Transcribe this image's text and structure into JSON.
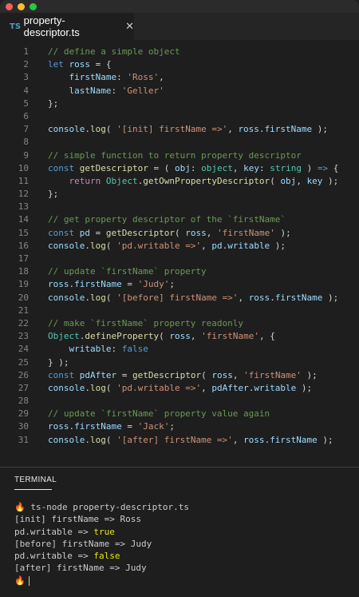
{
  "tab": {
    "type_label": "TS",
    "filename": "property-descriptor.ts"
  },
  "lines": [
    {
      "n": "1",
      "t": [
        [
          "cm",
          "// define a simple object"
        ]
      ]
    },
    {
      "n": "2",
      "t": [
        [
          "kw",
          "let "
        ],
        [
          "vr",
          "ross"
        ],
        [
          "pn",
          " = {"
        ]
      ]
    },
    {
      "n": "3",
      "t": [
        [
          "pn",
          "    "
        ],
        [
          "vr",
          "firstName"
        ],
        [
          "pn",
          ": "
        ],
        [
          "st",
          "'Ross'"
        ],
        [
          "pn",
          ","
        ]
      ]
    },
    {
      "n": "4",
      "t": [
        [
          "pn",
          "    "
        ],
        [
          "vr",
          "lastName"
        ],
        [
          "pn",
          ": "
        ],
        [
          "st",
          "'Geller'"
        ]
      ]
    },
    {
      "n": "5",
      "t": [
        [
          "pn",
          "};"
        ]
      ]
    },
    {
      "n": "6",
      "t": []
    },
    {
      "n": "7",
      "t": [
        [
          "vr",
          "console"
        ],
        [
          "pn",
          "."
        ],
        [
          "fn",
          "log"
        ],
        [
          "pn",
          "( "
        ],
        [
          "st",
          "'[init] firstName =>'"
        ],
        [
          "pn",
          ", "
        ],
        [
          "vr",
          "ross"
        ],
        [
          "pn",
          "."
        ],
        [
          "vr",
          "firstName"
        ],
        [
          "pn",
          " );"
        ]
      ]
    },
    {
      "n": "8",
      "t": []
    },
    {
      "n": "9",
      "t": [
        [
          "cm",
          "// simple function to return property descriptor"
        ]
      ]
    },
    {
      "n": "10",
      "t": [
        [
          "kw",
          "const "
        ],
        [
          "fn",
          "getDescriptor"
        ],
        [
          "pn",
          " = ( "
        ],
        [
          "vr",
          "obj"
        ],
        [
          "pn",
          ": "
        ],
        [
          "cls",
          "object"
        ],
        [
          "pn",
          ", "
        ],
        [
          "vr",
          "key"
        ],
        [
          "pn",
          ": "
        ],
        [
          "cls",
          "string"
        ],
        [
          "pn",
          " ) "
        ],
        [
          "kw",
          "=>"
        ],
        [
          "pn",
          " {"
        ]
      ]
    },
    {
      "n": "11",
      "t": [
        [
          "pn",
          "    "
        ],
        [
          "ctl",
          "return "
        ],
        [
          "cls",
          "Object"
        ],
        [
          "pn",
          "."
        ],
        [
          "fn",
          "getOwnPropertyDescriptor"
        ],
        [
          "pn",
          "( "
        ],
        [
          "vr",
          "obj"
        ],
        [
          "pn",
          ", "
        ],
        [
          "vr",
          "key"
        ],
        [
          "pn",
          " );"
        ]
      ]
    },
    {
      "n": "12",
      "t": [
        [
          "pn",
          "};"
        ]
      ]
    },
    {
      "n": "13",
      "t": []
    },
    {
      "n": "14",
      "t": [
        [
          "cm",
          "// get property descriptor of the `firstName`"
        ]
      ]
    },
    {
      "n": "15",
      "t": [
        [
          "kw",
          "const "
        ],
        [
          "vr",
          "pd"
        ],
        [
          "pn",
          " = "
        ],
        [
          "fn",
          "getDescriptor"
        ],
        [
          "pn",
          "( "
        ],
        [
          "vr",
          "ross"
        ],
        [
          "pn",
          ", "
        ],
        [
          "st",
          "'firstName'"
        ],
        [
          "pn",
          " );"
        ]
      ]
    },
    {
      "n": "16",
      "t": [
        [
          "vr",
          "console"
        ],
        [
          "pn",
          "."
        ],
        [
          "fn",
          "log"
        ],
        [
          "pn",
          "( "
        ],
        [
          "st",
          "'pd.writable =>'"
        ],
        [
          "pn",
          ", "
        ],
        [
          "vr",
          "pd"
        ],
        [
          "pn",
          "."
        ],
        [
          "vr",
          "writable"
        ],
        [
          "pn",
          " );"
        ]
      ]
    },
    {
      "n": "17",
      "t": []
    },
    {
      "n": "18",
      "t": [
        [
          "cm",
          "// update `firstName` property"
        ]
      ]
    },
    {
      "n": "19",
      "t": [
        [
          "vr",
          "ross"
        ],
        [
          "pn",
          "."
        ],
        [
          "vr",
          "firstName"
        ],
        [
          "pn",
          " = "
        ],
        [
          "st",
          "'Judy'"
        ],
        [
          "pn",
          ";"
        ]
      ]
    },
    {
      "n": "20",
      "t": [
        [
          "vr",
          "console"
        ],
        [
          "pn",
          "."
        ],
        [
          "fn",
          "log"
        ],
        [
          "pn",
          "( "
        ],
        [
          "st",
          "'[before] firstName =>'"
        ],
        [
          "pn",
          ", "
        ],
        [
          "vr",
          "ross"
        ],
        [
          "pn",
          "."
        ],
        [
          "vr",
          "firstName"
        ],
        [
          "pn",
          " );"
        ]
      ]
    },
    {
      "n": "21",
      "t": []
    },
    {
      "n": "22",
      "t": [
        [
          "cm",
          "// make `firstName` property readonly"
        ]
      ]
    },
    {
      "n": "23",
      "t": [
        [
          "cls",
          "Object"
        ],
        [
          "pn",
          "."
        ],
        [
          "fn",
          "defineProperty"
        ],
        [
          "pn",
          "( "
        ],
        [
          "vr",
          "ross"
        ],
        [
          "pn",
          ", "
        ],
        [
          "st",
          "'firstName'"
        ],
        [
          "pn",
          ", {"
        ]
      ]
    },
    {
      "n": "24",
      "t": [
        [
          "pn",
          "    "
        ],
        [
          "vr",
          "writable"
        ],
        [
          "pn",
          ": "
        ],
        [
          "kw",
          "false"
        ]
      ]
    },
    {
      "n": "25",
      "t": [
        [
          "pn",
          "} );"
        ]
      ]
    },
    {
      "n": "26",
      "t": [
        [
          "kw",
          "const "
        ],
        [
          "vr",
          "pdAfter"
        ],
        [
          "pn",
          " = "
        ],
        [
          "fn",
          "getDescriptor"
        ],
        [
          "pn",
          "( "
        ],
        [
          "vr",
          "ross"
        ],
        [
          "pn",
          ", "
        ],
        [
          "st",
          "'firstName'"
        ],
        [
          "pn",
          " );"
        ]
      ]
    },
    {
      "n": "27",
      "t": [
        [
          "vr",
          "console"
        ],
        [
          "pn",
          "."
        ],
        [
          "fn",
          "log"
        ],
        [
          "pn",
          "( "
        ],
        [
          "st",
          "'pd.writable =>'"
        ],
        [
          "pn",
          ", "
        ],
        [
          "vr",
          "pdAfter"
        ],
        [
          "pn",
          "."
        ],
        [
          "vr",
          "writable"
        ],
        [
          "pn",
          " );"
        ]
      ]
    },
    {
      "n": "28",
      "t": []
    },
    {
      "n": "29",
      "t": [
        [
          "cm",
          "// update `firstName` property value again"
        ]
      ]
    },
    {
      "n": "30",
      "t": [
        [
          "vr",
          "ross"
        ],
        [
          "pn",
          "."
        ],
        [
          "vr",
          "firstName"
        ],
        [
          "pn",
          " = "
        ],
        [
          "st",
          "'Jack'"
        ],
        [
          "pn",
          ";"
        ]
      ]
    },
    {
      "n": "31",
      "t": [
        [
          "vr",
          "console"
        ],
        [
          "pn",
          "."
        ],
        [
          "fn",
          "log"
        ],
        [
          "pn",
          "( "
        ],
        [
          "st",
          "'[after] firstName =>'"
        ],
        [
          "pn",
          ", "
        ],
        [
          "vr",
          "ross"
        ],
        [
          "pn",
          "."
        ],
        [
          "vr",
          "firstName"
        ],
        [
          "pn",
          " );"
        ]
      ]
    }
  ],
  "terminal": {
    "tab_label": "TERMINAL",
    "lines": [
      [
        [
          "",
          "🔥 ts-node property-descriptor.ts"
        ]
      ],
      [
        [
          "",
          "[init] firstName => Ross"
        ]
      ],
      [
        [
          "",
          "pd.writable => "
        ],
        [
          "tyellow",
          "true"
        ]
      ],
      [
        [
          "",
          "[before] firstName => Judy"
        ]
      ],
      [
        [
          "",
          "pd.writable => "
        ],
        [
          "tyellow",
          "false"
        ]
      ],
      [
        [
          "",
          "[after] firstName => Judy"
        ]
      ],
      [
        [
          "",
          "🔥"
        ]
      ]
    ]
  }
}
